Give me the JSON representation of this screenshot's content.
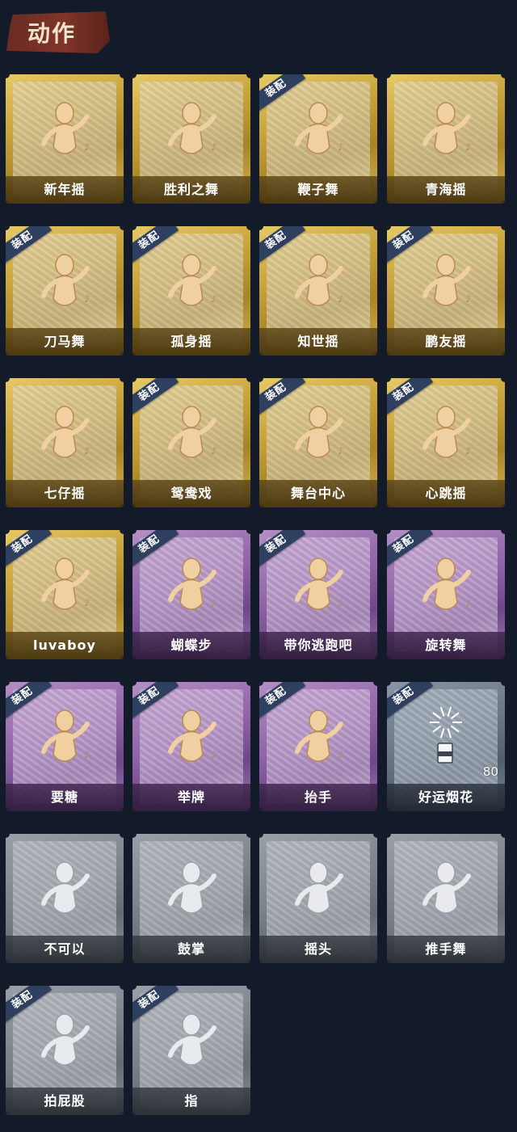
{
  "header": {
    "title": "动作"
  },
  "colors": {
    "background": "#131a29",
    "gold": "#c9a43c",
    "purple": "#8f63a6",
    "blue": "#687585",
    "gray": "#7c828b",
    "equip_badge": "#2f3f5f"
  },
  "equip_label": "装配",
  "cards": [
    {
      "label": "新年摇",
      "tier": "gold",
      "equipped": false,
      "icon": "dance-figure-icon"
    },
    {
      "label": "胜利之舞",
      "tier": "gold",
      "equipped": false,
      "icon": "victory-dance-icon"
    },
    {
      "label": "鞭子舞",
      "tier": "gold",
      "equipped": true,
      "icon": "whip-dance-icon"
    },
    {
      "label": "青海摇",
      "tier": "gold",
      "equipped": false,
      "icon": "dance-figure-icon"
    },
    {
      "label": "刀马舞",
      "tier": "gold",
      "equipped": true,
      "icon": "dance-figure-icon"
    },
    {
      "label": "孤身摇",
      "tier": "gold",
      "equipped": true,
      "icon": "dance-figure-icon"
    },
    {
      "label": "知世摇",
      "tier": "gold",
      "equipped": true,
      "icon": "dance-figure-icon"
    },
    {
      "label": "鹏友摇",
      "tier": "gold",
      "equipped": true,
      "icon": "dance-figure-icon"
    },
    {
      "label": "七仔摇",
      "tier": "gold",
      "equipped": false,
      "icon": "dance-figure-icon"
    },
    {
      "label": "鸳鸯戏",
      "tier": "gold",
      "equipped": true,
      "icon": "dance-figure-icon"
    },
    {
      "label": "舞台中心",
      "tier": "gold",
      "equipped": true,
      "icon": "dance-figure-icon"
    },
    {
      "label": "心跳摇",
      "tier": "gold",
      "equipped": true,
      "icon": "dance-figure-icon"
    },
    {
      "label": "luvaboy",
      "tier": "gold",
      "equipped": true,
      "icon": "dance-figure-icon"
    },
    {
      "label": "蝴蝶步",
      "tier": "purple",
      "equipped": true,
      "icon": "butterfly-step-icon"
    },
    {
      "label": "带你逃跑吧",
      "tier": "purple",
      "equipped": true,
      "icon": "dance-figure-icon"
    },
    {
      "label": "旋转舞",
      "tier": "purple",
      "equipped": true,
      "icon": "spin-dance-icon"
    },
    {
      "label": "要糖",
      "tier": "purple",
      "equipped": true,
      "icon": "ask-candy-icon"
    },
    {
      "label": "举牌",
      "tier": "purple",
      "equipped": true,
      "icon": "hold-sign-icon"
    },
    {
      "label": "抬手",
      "tier": "purple",
      "equipped": true,
      "icon": "raise-hand-icon"
    },
    {
      "label": "好运烟花",
      "tier": "blue",
      "equipped": true,
      "icon": "firework-icon",
      "quantity": "80"
    },
    {
      "label": "不可以",
      "tier": "gray",
      "equipped": false,
      "icon": "finger-no-icon"
    },
    {
      "label": "鼓掌",
      "tier": "gray",
      "equipped": false,
      "icon": "clap-icon"
    },
    {
      "label": "摇头",
      "tier": "gray",
      "equipped": false,
      "icon": "shake-head-icon"
    },
    {
      "label": "推手舞",
      "tier": "gray",
      "equipped": false,
      "icon": "push-hand-icon"
    },
    {
      "label": "拍屁股",
      "tier": "gray",
      "equipped": true,
      "icon": "slap-butt-icon"
    },
    {
      "label": "指",
      "tier": "gray",
      "equipped": true,
      "icon": "point-icon"
    }
  ]
}
